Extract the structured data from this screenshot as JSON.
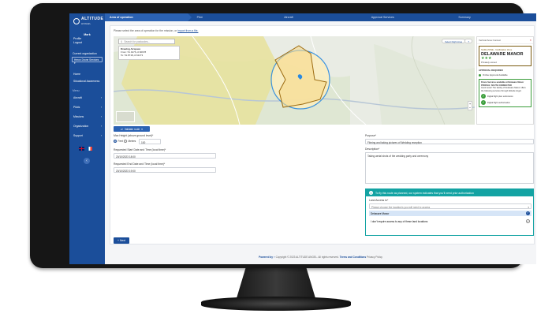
{
  "brand": {
    "name": "ALTITUDE",
    "sub": "ANGEL"
  },
  "user": {
    "name": "Mark",
    "profile": "Profile",
    "logout": "Logout"
  },
  "sidebar": {
    "org_label": "Current organization",
    "org_value": "Heron Drone Services",
    "section_label": "Menu",
    "items": [
      {
        "label": "Home"
      },
      {
        "label": "Situational Awareness"
      },
      {
        "label": "Aircraft"
      },
      {
        "label": "Pilots"
      },
      {
        "label": "Missions"
      },
      {
        "label": "Organization"
      },
      {
        "label": "Support"
      }
    ]
  },
  "steps": [
    {
      "label": "Area of operation"
    },
    {
      "label": "Pilot"
    },
    {
      "label": "Aircraft"
    },
    {
      "label": "Approval Services"
    },
    {
      "label": "Summary"
    }
  ],
  "instructions": {
    "text": "Please select the area of operation for the mission, or",
    "link": "import from a file."
  },
  "map": {
    "search_placeholder": "Search for postcodes...",
    "result_title": "Drawing Airspace",
    "result_from": "From: 51.9176,-0.60978",
    "result_to": "To: 51.8718,-0.61173",
    "btn_select": "Select Flight Area",
    "btn_help": "?"
  },
  "info_panel": {
    "header": "Vertical Area Context",
    "zone_type": "SAFE ZONE - Notification Zone",
    "zone_name": "DELAWARE MANOR",
    "zone_stars": "★★★",
    "zone_sub": "Privately owned",
    "status": "APPROVAL REQUIRED",
    "online": "Online Approval Available",
    "box_title": "Drone Services available at Delaware Manor",
    "box_sub": "PROFILE: SOUTH CONNECTED",
    "box_text": "Good news! The facility of Delaware Manor offers the following services through Altitude Angel.",
    "checks": [
      "Digital flight plan submission",
      "Digital flight authorisation"
    ]
  },
  "validate_label": "Validate route",
  "form": {
    "max_height_label": "Max Height (above ground level)*",
    "unit_feet": "Feet",
    "unit_metres": "Meters",
    "max_height_value": "100",
    "start_label": "Requested Start Date and Time (local time)*",
    "start_value": "20/10/2023 18:00",
    "end_label": "Requested End Date and Time (local time)*",
    "end_value": "20/10/2023 19:00",
    "purpose_label": "Purpose*",
    "purpose_value": "Filming and taking pictures of Wedding reception",
    "desc_label": "Description*",
    "desc_value": "Taking aerial shots of the wedding party and ceremony"
  },
  "fly_panel": {
    "header": "To fly this route as planned, our system indicates that you'll need prior authorisation",
    "land_label": "Land Access to*",
    "select_placeholder": "Please choose the location/s you will need to access",
    "options": [
      {
        "label": "Delaware Manor"
      },
      {
        "label": "I don't require access to any of these land locations"
      }
    ]
  },
  "next_label": "Next",
  "footer": {
    "powered": "Powered by",
    "copyright": "Copyright © 2023 ALTITUDE ANGEL. All rights reserved.",
    "terms": "Terms and Conditions",
    "privacy": "Privacy Policy"
  }
}
